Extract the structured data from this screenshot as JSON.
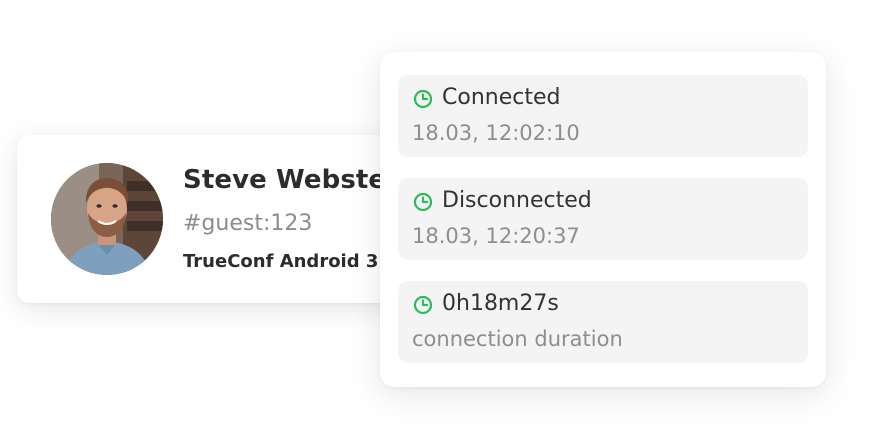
{
  "user": {
    "name": "Steve Webster",
    "guest_id": "#guest:123",
    "client": "TrueConf Android 3"
  },
  "connection_events": [
    {
      "title": "Connected",
      "subtitle": "18.03, 12:02:10",
      "icon": "clock-icon"
    },
    {
      "title": "Disconnected",
      "subtitle": "18.03, 12:20:37",
      "icon": "clock-icon"
    },
    {
      "title": "0h18m27s",
      "subtitle": "connection duration",
      "icon": "clock-icon"
    }
  ],
  "colors": {
    "icon_green": "#2dbb5a",
    "card_background": "#f4f4f4",
    "primary_text": "#333333",
    "secondary_text": "#8e8e8e"
  }
}
